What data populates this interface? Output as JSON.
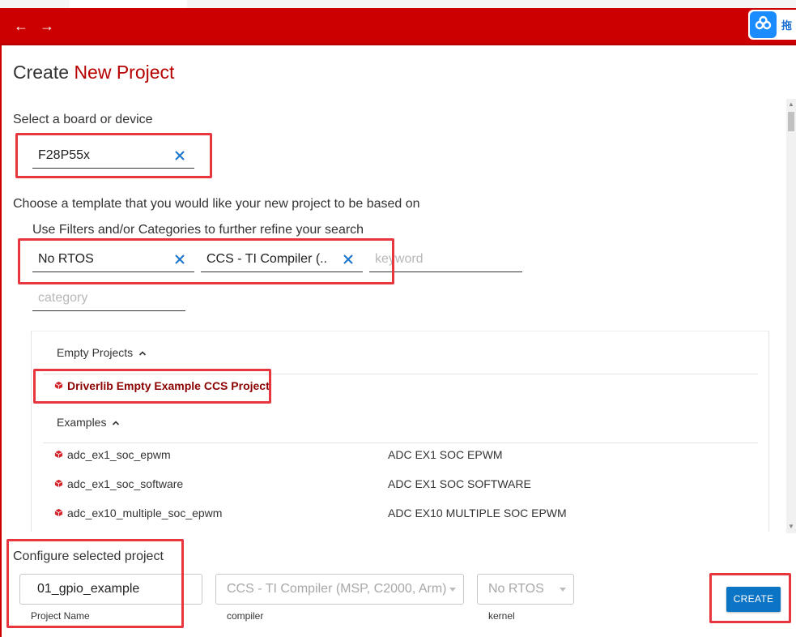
{
  "nav": {
    "back_glyph": "←",
    "forward_glyph": "→"
  },
  "extension": {
    "label": "拖"
  },
  "page": {
    "title_prefix": "Create",
    "title_accent": "New Project"
  },
  "board": {
    "label": "Select a board or device",
    "value": "F28P55x"
  },
  "template": {
    "label": "Choose a template that you would like your new project to be based on",
    "filter_hint": "Use Filters and/or Categories to further refine your search",
    "filters": {
      "rtos_value": "No RTOS",
      "compiler_value": "CCS - TI Compiler (...",
      "keyword_placeholder": "keyword",
      "category_placeholder": "category"
    }
  },
  "list": {
    "empty_group": "Empty Projects",
    "empty_items": [
      {
        "name": "Driverlib Empty Example CCS Project"
      }
    ],
    "examples_group": "Examples",
    "examples": [
      {
        "name": "adc_ex1_soc_epwm",
        "desc": "ADC EX1 SOC EPWM"
      },
      {
        "name": "adc_ex1_soc_software",
        "desc": "ADC EX1 SOC SOFTWARE"
      },
      {
        "name": "adc_ex10_multiple_soc_epwm",
        "desc": "ADC EX10 MULTIPLE SOC EPWM"
      }
    ]
  },
  "configure": {
    "label": "Configure selected project",
    "project_name": "01_gpio_example",
    "project_name_label": "Project Name",
    "compiler_value": "CCS - TI Compiler (MSP, C2000, Arm)",
    "compiler_label": "compiler",
    "kernel_value": "No RTOS",
    "kernel_label": "kernel"
  },
  "create_label": "CREATE",
  "colors": {
    "toolbar": "#cc0000",
    "accent": "#b70000",
    "highlight": "#e8363e",
    "button": "#0c74c4"
  }
}
